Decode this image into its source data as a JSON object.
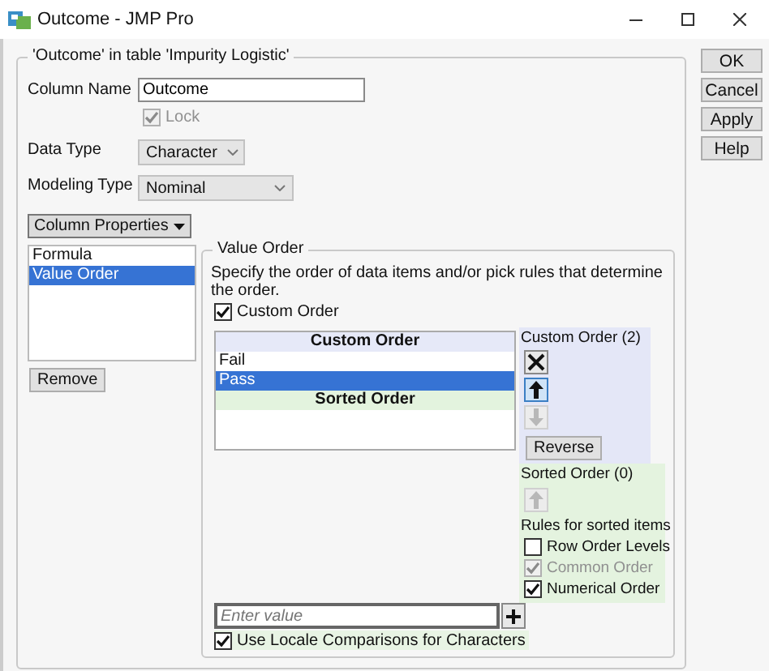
{
  "window": {
    "title": "Outcome - JMP Pro"
  },
  "dialog_buttons": [
    "OK",
    "Cancel",
    "Apply",
    "Help"
  ],
  "column_panel": {
    "title": "'Outcome' in table 'Impurity Logistic'",
    "column_name": {
      "label": "Column Name",
      "value": "Outcome"
    },
    "lock": {
      "label": "Lock",
      "checked": true,
      "disabled": true
    },
    "data_type": {
      "label": "Data Type",
      "value": "Character"
    },
    "modeling_type": {
      "label": "Modeling Type",
      "value": "Nominal"
    },
    "properties_button": "Column Properties",
    "properties": [
      {
        "label": "Formula",
        "selected": false
      },
      {
        "label": "Value Order",
        "selected": true
      }
    ],
    "remove_button": "Remove"
  },
  "value_order": {
    "title": "Value Order",
    "description": "Specify the order of data items and/or pick rules that determine the order.",
    "custom_order": {
      "label": "Custom Order",
      "checked": true
    },
    "list_header": "Custom Order",
    "items": [
      {
        "label": "Fail",
        "selected": false
      },
      {
        "label": "Pass",
        "selected": true
      }
    ],
    "sorted_header": "Sorted Order",
    "custom_panel": {
      "title": "Custom Order (2)",
      "tools": [
        {
          "kind": "delete",
          "disabled": false
        },
        {
          "kind": "up",
          "disabled": false
        },
        {
          "kind": "down",
          "disabled": true
        }
      ],
      "reverse_button": "Reverse"
    },
    "sorted_panel": {
      "title": "Sorted Order (0)",
      "tools": [
        {
          "kind": "up",
          "disabled": true
        }
      ],
      "rules_title": "Rules for sorted items",
      "rules": [
        {
          "label": "Row Order Levels",
          "checked": false,
          "disabled": false
        },
        {
          "label": "Common Order",
          "checked": true,
          "disabled": true
        },
        {
          "label": "Numerical Order",
          "checked": true,
          "disabled": false
        }
      ]
    },
    "value_input": {
      "placeholder": "Enter value"
    },
    "locale": {
      "label": "Use Locale Comparisons for Characters",
      "checked": true
    }
  }
}
